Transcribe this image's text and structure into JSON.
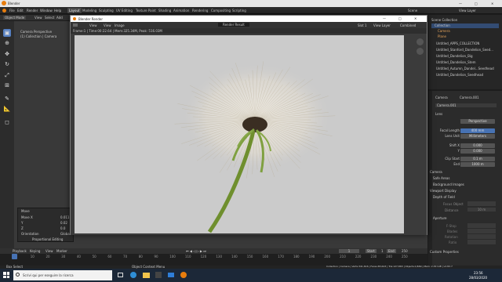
{
  "app": {
    "title": "Blender",
    "controls": [
      "—",
      "□",
      "✕"
    ]
  },
  "menu": {
    "items": [
      "File",
      "Edit",
      "Render",
      "Window",
      "Help"
    ],
    "workspaces": [
      "Layout",
      "Modeling",
      "Sculpting",
      "UV Editing",
      "Texture Paint",
      "Shading",
      "Animation",
      "Rendering",
      "Compositing",
      "Scripting"
    ],
    "active_workspace": "Layout",
    "scene": "Scene",
    "view_layer": "View Layer"
  },
  "viewport": {
    "mode": "Object Mode",
    "menus": [
      "View",
      "Select",
      "Add",
      "Object"
    ],
    "camera_label": "Camera Perspective",
    "collection_label": "(1) Collection | Camera"
  },
  "move_panel": {
    "title": "Move",
    "labels": [
      "Move X",
      "Y",
      "Z",
      "Orientation",
      "Proportional Editing"
    ],
    "values": [
      "0.011",
      "0.02",
      "0.0",
      "Global"
    ]
  },
  "render": {
    "window_title": "Blender Render",
    "menus": [
      "View",
      "View",
      "Image"
    ],
    "slot_select": "Render Result",
    "slot": "Slot 1",
    "layer": "View Layer",
    "pass": "Combined",
    "info": "Frame:1 | Time:00:22.64 | Mem:325.34M, Peak: 516.03M"
  },
  "outliner": {
    "items": [
      "Scene Collection",
      "Collection",
      "Camera",
      "Plane",
      "Untitled_APPS_COLLECTION",
      "Untitled_Stanford_Dandelion_Seed...",
      "Untitled_Dandelion_Big",
      "Untitled_Dandelion_Stem",
      "Untitled_Autumn_Dandel...Seedhead",
      "Untitled_Dandelion_Seedhead"
    ]
  },
  "properties": {
    "object": "Camera",
    "data": "Camera.001",
    "data_field": "Camera.001",
    "section_lens": "Lens",
    "rows": [
      {
        "label": "Type",
        "value": "Perspective"
      },
      {
        "label": "Focal Length",
        "value": "400 mm"
      },
      {
        "label": "Lens Unit",
        "value": "Millimeters"
      },
      {
        "label": "Shift X",
        "value": "0.000"
      },
      {
        "label": "Y",
        "value": "0.000"
      },
      {
        "label": "Clip Start",
        "value": "0.1 m"
      },
      {
        "label": "End",
        "value": "1000 m"
      }
    ],
    "sections": [
      "Camera",
      "Safe Areas",
      "Background Images",
      "Viewport Display",
      "Depth of Field",
      "Aperture",
      "Custom Properties"
    ],
    "dof": {
      "focus_label": "Focus Object",
      "distance_label": "Distance",
      "distance_value": "10 m"
    },
    "aperture": [
      "F-Stop",
      "Blades",
      "Rotation",
      "Ratio"
    ]
  },
  "timeline": {
    "menus": [
      "Playback",
      "Keying",
      "View",
      "Marker"
    ],
    "frame": "1",
    "start_label": "Start",
    "start": "1",
    "end_label": "End",
    "end": "250",
    "ticks": [
      "1",
      "10",
      "20",
      "30",
      "40",
      "50",
      "60",
      "70",
      "80",
      "90",
      "100",
      "110",
      "120",
      "130",
      "140",
      "150",
      "160",
      "170",
      "180",
      "190",
      "200",
      "210",
      "220",
      "230",
      "240",
      "250"
    ]
  },
  "status": {
    "left": "Box Select",
    "middle": "Object Context Menu",
    "right": "Collection | Camera | Verts:341,616 | Faces:83,643 | Tris:127,863 | Objects:1/669 | Mem: 2.29 GiB | v2.82.7"
  },
  "taskbar": {
    "search_placeholder": "Scrivi qui per eseguire la ricerca",
    "time": "23:56",
    "date": "28/03/2020"
  }
}
